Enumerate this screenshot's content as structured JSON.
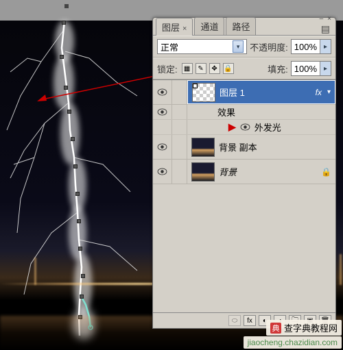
{
  "tabs": {
    "layers": "图层",
    "channels": "通道",
    "paths": "路径"
  },
  "blend": {
    "mode": "正常",
    "opacity_label": "不透明度:",
    "opacity_value": "100%"
  },
  "lock": {
    "label": "锁定:",
    "fill_label": "填充:",
    "fill_value": "100%"
  },
  "layers": {
    "layer1": {
      "name": "图层 1",
      "fx": "fx"
    },
    "effects": "效果",
    "outer_glow": "外发光",
    "bg_copy": "背景 副本",
    "bg": "背景"
  },
  "watermark": {
    "text": "查字典教程网",
    "url": "jiaocheng.chazidian.com"
  }
}
